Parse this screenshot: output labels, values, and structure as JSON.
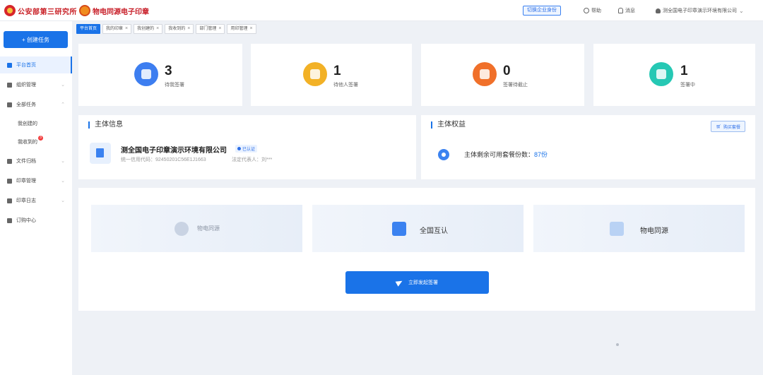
{
  "header": {
    "org_name": "公安部第三研究所",
    "system_name": "物电同源电子印章",
    "switch_label": "切换企业身份",
    "help_label": "帮助",
    "message_label": "消息",
    "user_name": "测全国电子印章演示环境有限公司"
  },
  "sidebar": {
    "create_label": "+ 创建任务",
    "items": [
      {
        "label": "平台首页"
      },
      {
        "label": "组织管理"
      },
      {
        "label": "全部任务"
      },
      {
        "label": "文件归档"
      },
      {
        "label": "印章管理"
      },
      {
        "label": "印章日志"
      },
      {
        "label": "订购中心"
      }
    ],
    "sub_items": [
      {
        "label": "我创建的"
      },
      {
        "label": "我收到的",
        "badge": "3"
      }
    ]
  },
  "tabs": [
    {
      "label": "平台首页"
    },
    {
      "label": "我的印章"
    },
    {
      "label": "我创建的"
    },
    {
      "label": "我收到的"
    },
    {
      "label": "部门管理"
    },
    {
      "label": "用印管理"
    }
  ],
  "stats": [
    {
      "value": "3",
      "label": "待我签署",
      "color": "#3d7ef0"
    },
    {
      "value": "1",
      "label": "待他人签署",
      "color": "#f2b126"
    },
    {
      "value": "0",
      "label": "签署待截止",
      "color": "#f0702a"
    },
    {
      "value": "1",
      "label": "签署中",
      "color": "#26c8b4"
    }
  ],
  "entity": {
    "title": "主体信息",
    "name": "测全国电子印章演示环境有限公司",
    "cert_label": "已认证",
    "credit_code": "统一信用代码：92450201C56E1J1663",
    "legal_rep": "法定代表人：刘***"
  },
  "rights": {
    "title": "主体权益",
    "buy_label": "购买套餐",
    "remaining_label": "主体剩余可用套餐份数：",
    "remaining_count": "87份"
  },
  "features": [
    {
      "label": "物电同源"
    },
    {
      "label": "全国互认"
    },
    {
      "label": "物电同源"
    }
  ],
  "action": {
    "start_label": "立即发起签署"
  },
  "colors": {
    "primary": "#1a73e8",
    "sidebar_active_bg": "#eaf2ff"
  }
}
